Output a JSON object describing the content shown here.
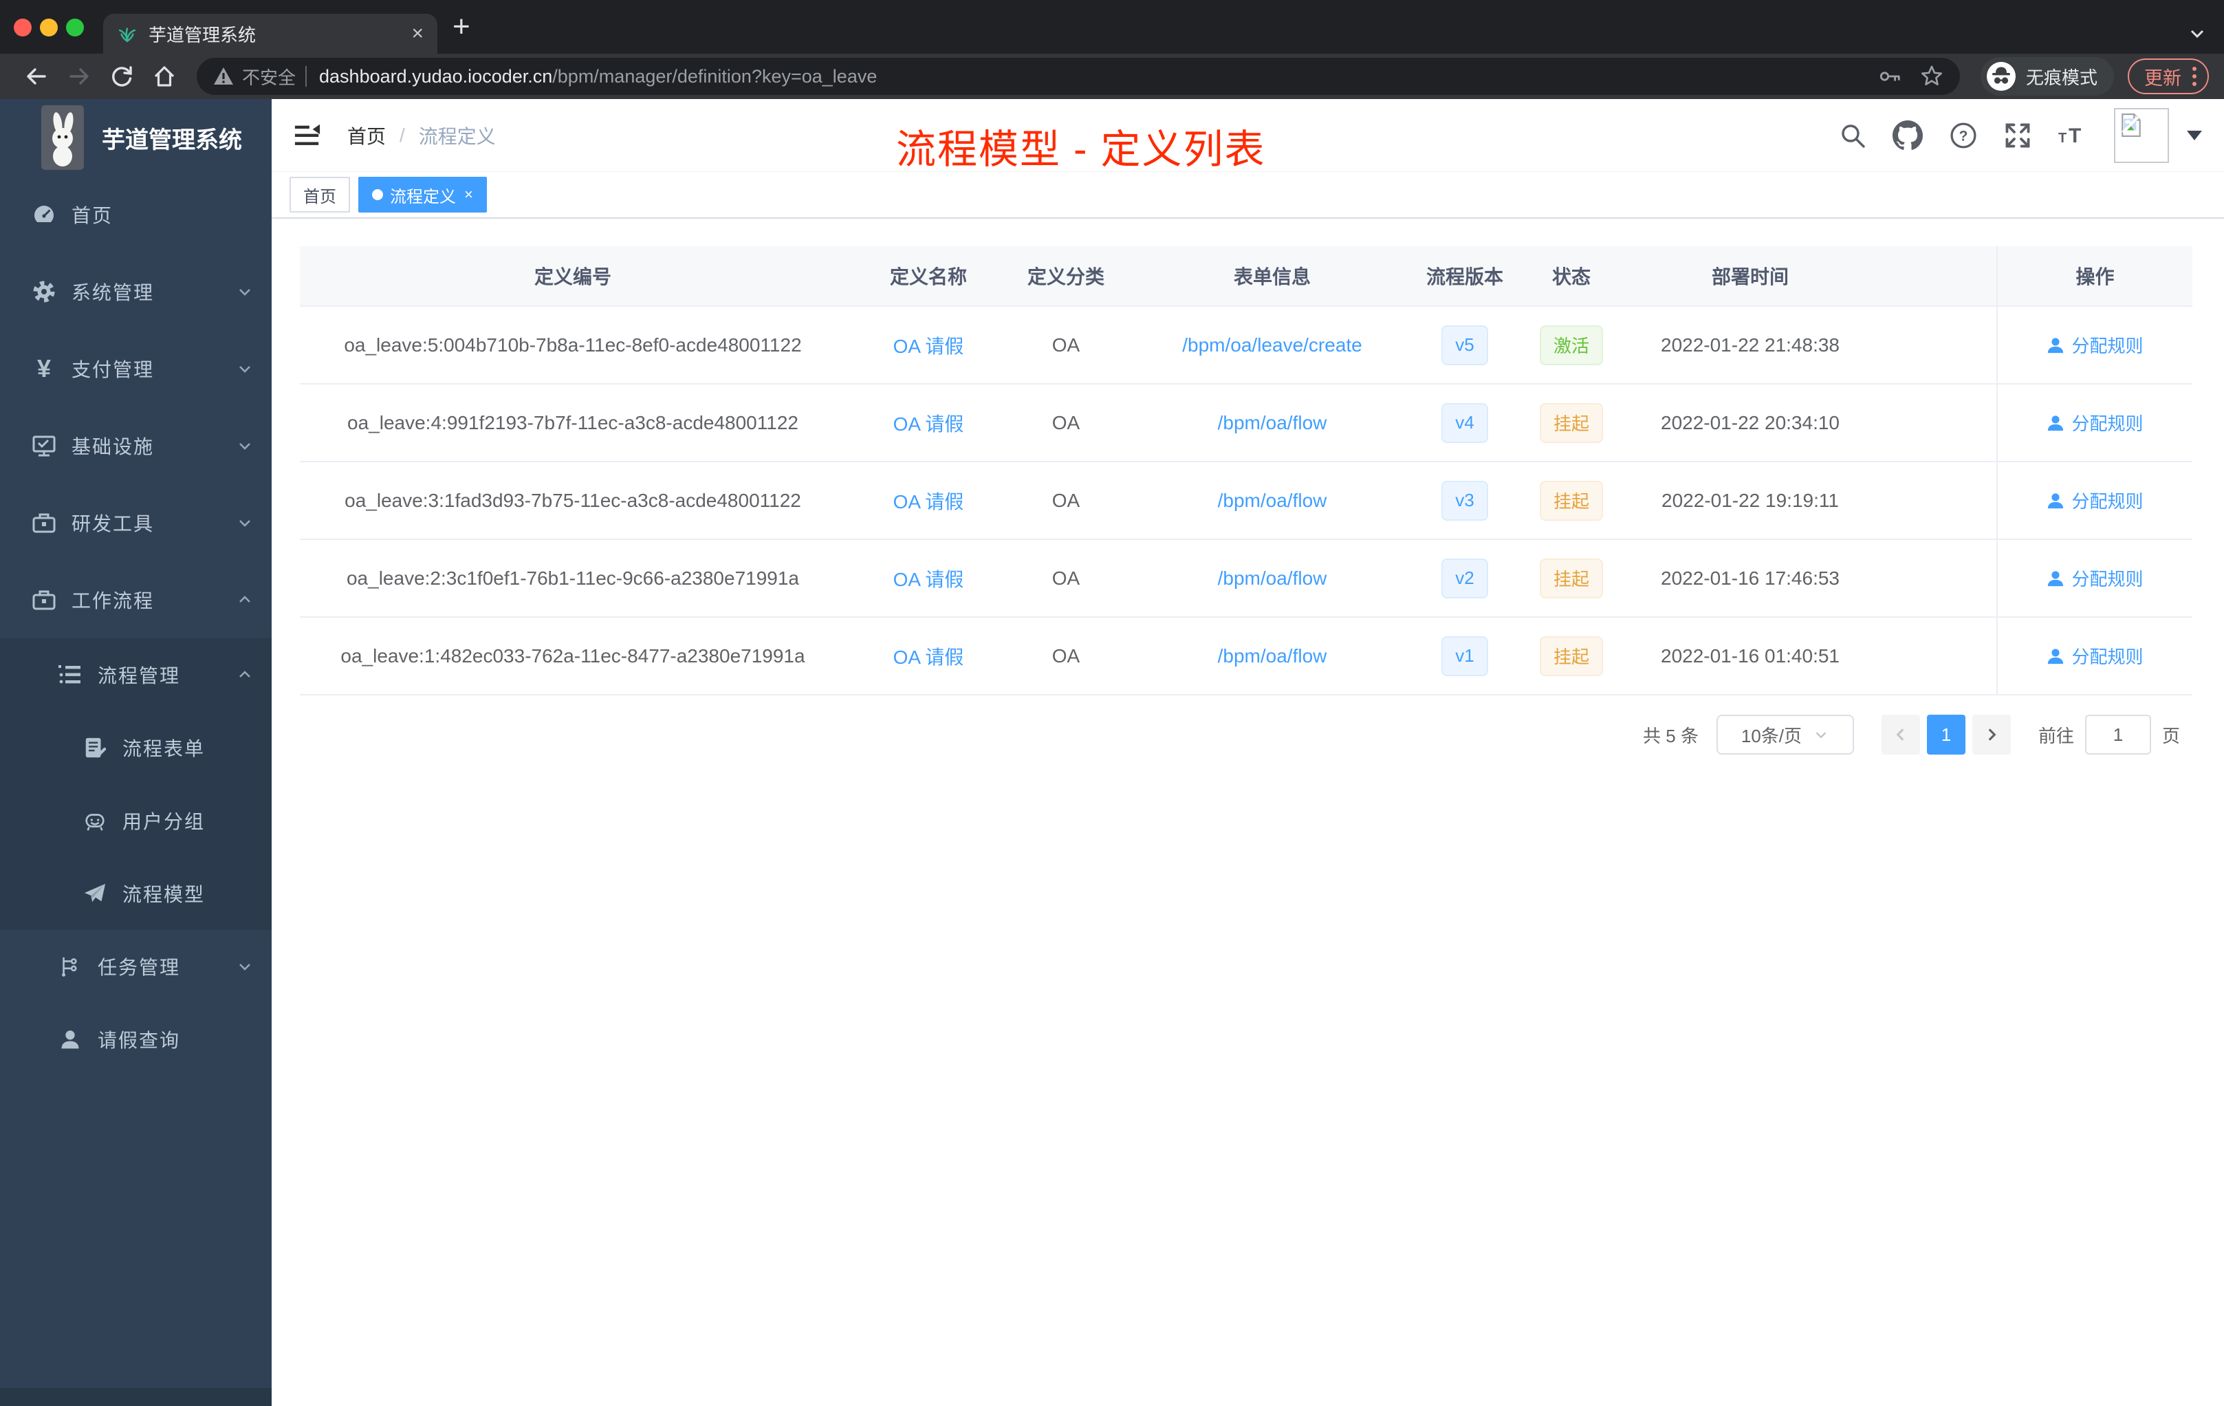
{
  "colors": {
    "accent": "#409eff",
    "success": "#67c23a",
    "warning": "#e6a23c",
    "overlay_title_red": "#fe2b00",
    "sidebar_bg": "#304156",
    "active_tag_blue": "#409eff"
  },
  "browser": {
    "tab_title": "芋道管理系统",
    "not_secure": "不安全",
    "url_domain": "dashboard.yudao.iocoder.cn",
    "url_path": "/bpm/manager/definition?key=oa_leave",
    "incognito_label": "无痕模式",
    "update_label": "更新",
    "new_tab_glyph": "+",
    "close_glyph": "×"
  },
  "sidebar": {
    "brand": "芋道管理系统",
    "items": [
      {
        "label": "首页",
        "icon": "dashboard-icon"
      },
      {
        "label": "系统管理",
        "icon": "gear-icon",
        "arrow": "down"
      },
      {
        "label": "支付管理",
        "icon": "yen-icon",
        "arrow": "down"
      },
      {
        "label": "基础设施",
        "icon": "monitor-icon",
        "arrow": "down"
      },
      {
        "label": "研发工具",
        "icon": "toolbox-icon",
        "arrow": "down"
      },
      {
        "label": "工作流程",
        "icon": "briefcase-icon",
        "arrow": "up"
      },
      {
        "label": "流程管理",
        "icon": "list-icon",
        "arrow": "up"
      },
      {
        "label": "流程表单",
        "icon": "form-icon"
      },
      {
        "label": "用户分组",
        "icon": "robot-icon"
      },
      {
        "label": "流程模型",
        "icon": "paper-plane-icon"
      },
      {
        "label": "任务管理",
        "icon": "flow-tree-icon",
        "arrow": "down"
      },
      {
        "label": "请假查询",
        "icon": "user-icon"
      }
    ],
    "yen_glyph": "¥"
  },
  "header": {
    "breadcrumb_home": "首页",
    "breadcrumb_sep": "/",
    "breadcrumb_current": "流程定义",
    "overlay_title": "流程模型 - 定义列表"
  },
  "tags": {
    "home": "首页",
    "active": "流程定义",
    "close_glyph": "×"
  },
  "table": {
    "headers": [
      "定义编号",
      "定义名称",
      "定义分类",
      "表单信息",
      "流程版本",
      "状态",
      "部署时间",
      "操作"
    ],
    "rows": [
      {
        "id": "oa_leave:5:004b710b-7b8a-11ec-8ef0-acde48001122",
        "name": "OA 请假",
        "category": "OA",
        "form": "/bpm/oa/leave/create",
        "version": "v5",
        "status": "激活",
        "deployed": "2022-01-22 21:48:38",
        "action": "分配规则"
      },
      {
        "id": "oa_leave:4:991f2193-7b7f-11ec-a3c8-acde48001122",
        "name": "OA 请假",
        "category": "OA",
        "form": "/bpm/oa/flow",
        "version": "v4",
        "status": "挂起",
        "deployed": "2022-01-22 20:34:10",
        "action": "分配规则"
      },
      {
        "id": "oa_leave:3:1fad3d93-7b75-11ec-a3c8-acde48001122",
        "name": "OA 请假",
        "category": "OA",
        "form": "/bpm/oa/flow",
        "version": "v3",
        "status": "挂起",
        "deployed": "2022-01-22 19:19:11",
        "action": "分配规则"
      },
      {
        "id": "oa_leave:2:3c1f0ef1-76b1-11ec-9c66-a2380e71991a",
        "name": "OA 请假",
        "category": "OA",
        "form": "/bpm/oa/flow",
        "version": "v2",
        "status": "挂起",
        "deployed": "2022-01-16 17:46:53",
        "action": "分配规则"
      },
      {
        "id": "oa_leave:1:482ec033-762a-11ec-8477-a2380e71991a",
        "name": "OA 请假",
        "category": "OA",
        "form": "/bpm/oa/flow",
        "version": "v1",
        "status": "挂起",
        "deployed": "2022-01-16 01:40:51",
        "action": "分配规则"
      }
    ]
  },
  "pagination": {
    "total": "共 5 条",
    "page_size": "10条/页",
    "page": "1",
    "goto_label": "前往",
    "goto_value": "1",
    "unit": "页"
  }
}
